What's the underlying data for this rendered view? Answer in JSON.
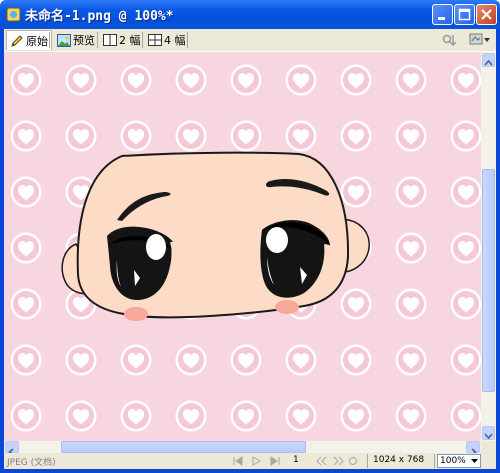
{
  "window": {
    "title": "未命名-1.png @ 100%*",
    "buttons": [
      "minimize",
      "maximize",
      "close"
    ]
  },
  "toolbar": {
    "original_label": "原始",
    "preview_label": "预览",
    "two_up_label": "2 幅",
    "four_up_label": "4 幅"
  },
  "status": {
    "format": "JPEG (文档)",
    "frame": "1",
    "size": "1024 x 768",
    "zoom": "100%"
  },
  "colors": {
    "background_pink": "#f8d6e0",
    "heart": "#f4c8d4",
    "skin": "#fcdcc7",
    "blush": "#f7a898",
    "title_bar": "#0758e7"
  }
}
